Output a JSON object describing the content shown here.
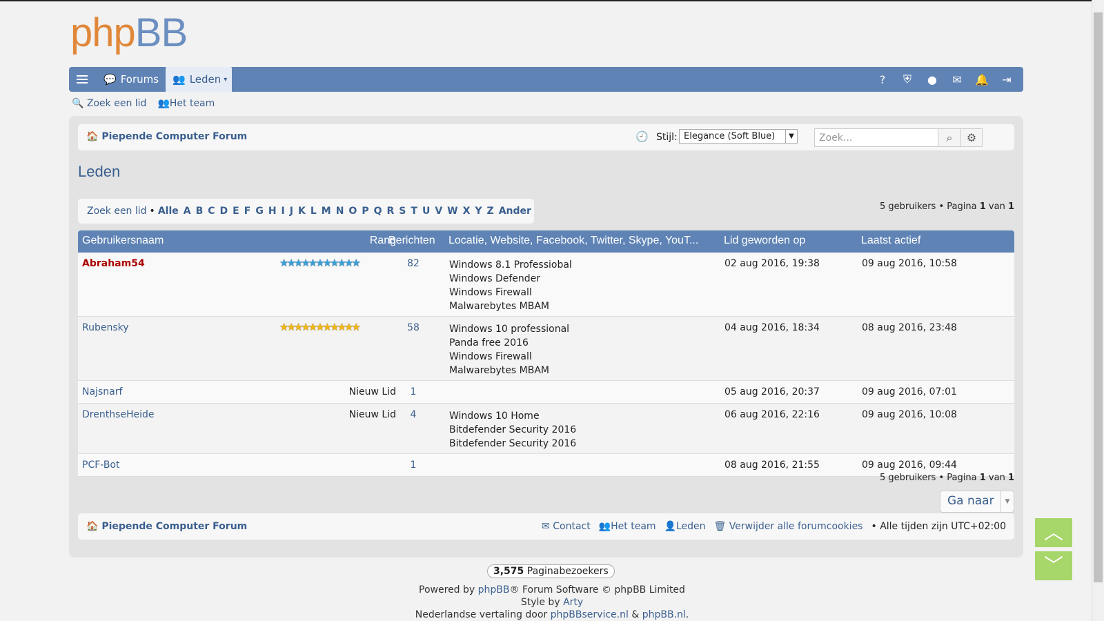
{
  "logo": {
    "php": "php",
    "bb": "BB"
  },
  "navbar": {
    "forums": "Forums",
    "leden": "Leden",
    "icons": [
      "help-icon",
      "shield-icon",
      "user-icon",
      "mail-icon",
      "bell-icon",
      "logout-icon"
    ]
  },
  "quicklinks": {
    "search_member": "Zoek een lid",
    "team": "Het team"
  },
  "breadcrumb": {
    "forum": "Piepende Computer Forum"
  },
  "style": {
    "label": "Stijl:",
    "selected": "Elegance (Soft Blue)"
  },
  "search": {
    "placeholder": "Zoek..."
  },
  "page": {
    "title": "Leden"
  },
  "letterbar": {
    "search_member": "Zoek een lid",
    "letters": [
      "Alle",
      "A",
      "B",
      "C",
      "D",
      "E",
      "F",
      "G",
      "H",
      "I",
      "J",
      "K",
      "L",
      "M",
      "N",
      "O",
      "P",
      "Q",
      "R",
      "S",
      "T",
      "U",
      "V",
      "W",
      "X",
      "Y",
      "Z",
      "Ander"
    ]
  },
  "pagination": {
    "users": "5 gebruikers",
    "sep": "•",
    "page_label": "Pagina",
    "page": "1",
    "of": "van",
    "total": "1"
  },
  "table": {
    "headers": {
      "username": "Gebruikersnaam",
      "rank": "Rang",
      "posts": "Berichten",
      "location": "Locatie, Website, Facebook, Twitter, Skype, YouT...",
      "joined": "Lid geworden op",
      "active": "Laatst actief"
    },
    "rows": [
      {
        "name": "Abraham54",
        "rank": "",
        "posts": "82",
        "location": [
          "Windows 8.1 Professiobal",
          "Windows Defender",
          "Windows Firewall",
          "Malwarebytes MBAM"
        ],
        "joined": "02 aug 2016, 19:38",
        "active": "09 aug 2016, 10:58"
      },
      {
        "name": "Rubensky",
        "rank": "",
        "posts": "58",
        "location": [
          "Windows 10 professional",
          "Panda free 2016",
          "Windows Firewall",
          "Malwarebytes MBAM"
        ],
        "joined": "04 aug 2016, 18:34",
        "active": "08 aug 2016, 23:48"
      },
      {
        "name": "Najsnarf",
        "rank": "Nieuw Lid",
        "posts": "1",
        "location": [],
        "joined": "05 aug 2016, 20:37",
        "active": "09 aug 2016, 07:01"
      },
      {
        "name": "DrenthseHeide",
        "rank": "Nieuw Lid",
        "posts": "4",
        "location": [
          "Windows 10 Home",
          "Bitdefender Security 2016",
          "Bitdefender Security 2016"
        ],
        "joined": "06 aug 2016, 22:16",
        "active": "09 aug 2016, 10:08"
      },
      {
        "name": "PCF-Bot",
        "rank": "",
        "posts": "1",
        "location": [],
        "joined": "08 aug 2016, 21:55",
        "active": "09 aug 2016, 09:44"
      }
    ]
  },
  "goto": {
    "label": "Ga naar"
  },
  "footer": {
    "forum": "Piepende Computer Forum",
    "contact": "Contact",
    "team": "Het team",
    "members": "Leden",
    "cookies": "Verwijder alle forumcookies",
    "timezone": "• Alle tijden zijn UTC+02:00"
  },
  "bottom": {
    "visitors_count": "3,575",
    "visitors_label": "Paginabezoekers",
    "powered_prefix": "Powered by",
    "phpbb": "phpBB",
    "powered_suffix": "® Forum Software © phpBB Limited",
    "style_prefix": "Style by",
    "arty": "Arty",
    "translation_prefix": "Nederlandse vertaling door",
    "phpbbservice": "phpBBservice.nl",
    "amp": "&",
    "phpbbnl": "phpBB.nl",
    "dot": "."
  }
}
